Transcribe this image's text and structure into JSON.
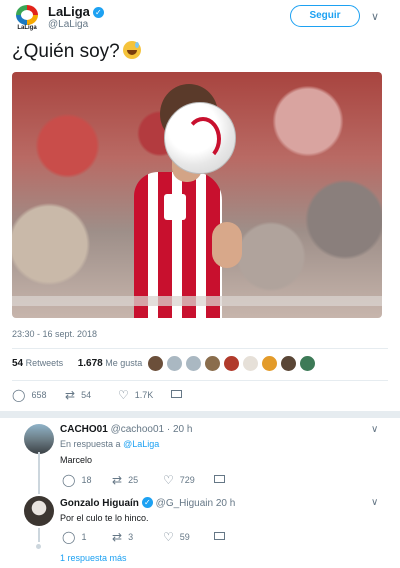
{
  "tweet": {
    "account_name": "LaLiga",
    "handle": "@LaLiga",
    "logo_text": "LaLiga",
    "follow_label": "Seguir",
    "text": "¿Quién soy?",
    "emoji": "sweat-smile-emoji",
    "timestamp": "23:30 - 16 sept. 2018",
    "retweets_count": "54",
    "retweets_label": "Retweets",
    "likes_count": "1.678",
    "likes_label": "Me gusta",
    "actions": {
      "reply_count": "658",
      "retweet_count": "54",
      "like_count": "1.7K"
    }
  },
  "replies": [
    {
      "name": "CACHO01",
      "handle": "@cachoo01",
      "age": "· 20 h",
      "in_reply_prefix": "En respuesta a",
      "in_reply_to": "@LaLiga",
      "text": "Marcelo",
      "reply_count": "18",
      "retweet_count": "25",
      "like_count": "729"
    },
    {
      "name": "Gonzalo Higuaín",
      "handle": "@G_Higuain",
      "age": "20 h",
      "text": "Por el culo te lo hinco.",
      "reply_count": "1",
      "retweet_count": "3",
      "like_count": "59"
    }
  ],
  "more_replies": "1 respuesta más",
  "colors": {
    "accent": "#1da1f2",
    "muted": "#657786",
    "text": "#14171a",
    "divider": "#e6ecf0"
  }
}
